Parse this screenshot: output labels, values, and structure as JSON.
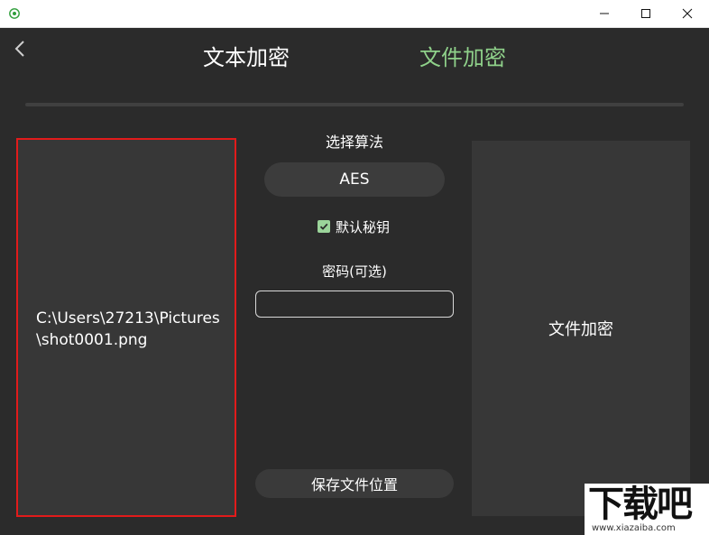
{
  "header": {
    "tabs": [
      {
        "label": "文本加密",
        "active": false
      },
      {
        "label": "文件加密",
        "active": true
      }
    ],
    "accent_color": "#8fd18a"
  },
  "file_panel": {
    "path": "C:\\Users\\27213\\Pictures\\shot0001.png",
    "highlight_color": "#e11b1b"
  },
  "controls": {
    "algorithm_label": "选择算法",
    "algorithm_value": "AES",
    "default_key_label": "默认秘钥",
    "default_key_checked": true,
    "password_label": "密码(可选)",
    "password_value": "",
    "save_location_label": "保存文件位置"
  },
  "action": {
    "encrypt_label": "文件加密"
  },
  "watermark": {
    "main": "下载吧",
    "sub": "www.xiazaiba.com"
  },
  "icons": {
    "app": "app-eye-icon",
    "back": "chevron-left-icon",
    "minimize": "minimize-icon",
    "maximize": "maximize-icon",
    "close": "close-icon",
    "check": "check-icon"
  }
}
